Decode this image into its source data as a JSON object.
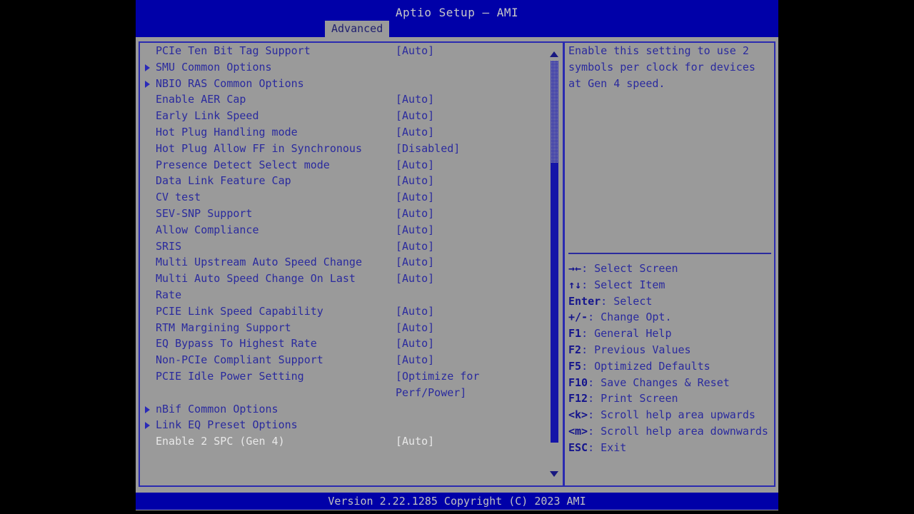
{
  "window": {
    "title": "Aptio Setup – AMI",
    "active_tab": "Advanced",
    "tabs": [
      "Advanced"
    ]
  },
  "colors": {
    "title_bar_bg": "#0000a8",
    "canvas_bg": "#9a9a9a",
    "text": "#2a2a9e",
    "selected_text": "#e8e8e8",
    "border": "#2a2ab0",
    "scrollbar_thumb": "#1414a8",
    "footer_bg": "#0000a8"
  },
  "menu": {
    "items": [
      {
        "label": "PCIe Ten Bit Tag Support",
        "value": "[Auto]",
        "submenu": false,
        "selected": false
      },
      {
        "label": "SMU Common Options",
        "value": "",
        "submenu": true,
        "selected": false
      },
      {
        "label": "NBIO RAS Common Options",
        "value": "",
        "submenu": true,
        "selected": false
      },
      {
        "label": "Enable AER Cap",
        "value": "[Auto]",
        "submenu": false,
        "selected": false
      },
      {
        "label": "Early Link Speed",
        "value": "[Auto]",
        "submenu": false,
        "selected": false
      },
      {
        "label": "Hot Plug Handling mode",
        "value": "[Auto]",
        "submenu": false,
        "selected": false
      },
      {
        "label": "Hot Plug Allow FF in Synchronous",
        "value": "[Disabled]",
        "submenu": false,
        "selected": false
      },
      {
        "label": "Presence Detect Select mode",
        "value": "[Auto]",
        "submenu": false,
        "selected": false
      },
      {
        "label": "Data Link Feature Cap",
        "value": "[Auto]",
        "submenu": false,
        "selected": false
      },
      {
        "label": "CV test",
        "value": "[Auto]",
        "submenu": false,
        "selected": false
      },
      {
        "label": "SEV-SNP Support",
        "value": "[Auto]",
        "submenu": false,
        "selected": false
      },
      {
        "label": "Allow Compliance",
        "value": "[Auto]",
        "submenu": false,
        "selected": false
      },
      {
        "label": "SRIS",
        "value": "[Auto]",
        "submenu": false,
        "selected": false
      },
      {
        "label": "Multi Upstream Auto Speed Change",
        "value": "[Auto]",
        "submenu": false,
        "selected": false
      },
      {
        "label": "Multi Auto Speed Change On Last",
        "value": "[Auto]",
        "submenu": false,
        "selected": false
      },
      {
        "label": "Rate",
        "value": "",
        "submenu": false,
        "selected": false,
        "continuation": true
      },
      {
        "label": "PCIE Link Speed Capability",
        "value": "[Auto]",
        "submenu": false,
        "selected": false
      },
      {
        "label": "RTM Margining Support",
        "value": "[Auto]",
        "submenu": false,
        "selected": false
      },
      {
        "label": "EQ Bypass To Highest Rate",
        "value": "[Auto]",
        "submenu": false,
        "selected": false
      },
      {
        "label": "Non-PCIe Compliant Support",
        "value": "[Auto]",
        "submenu": false,
        "selected": false
      },
      {
        "label": "PCIE Idle Power Setting",
        "value": "[Optimize for",
        "submenu": false,
        "selected": false
      },
      {
        "label": "",
        "value": "Perf/Power]",
        "submenu": false,
        "selected": false,
        "continuation": true
      },
      {
        "label": "nBif Common Options",
        "value": "",
        "submenu": true,
        "selected": false
      },
      {
        "label": "Link EQ Preset Options",
        "value": "",
        "submenu": true,
        "selected": false
      },
      {
        "label": "Enable 2 SPC (Gen 4)",
        "value": "[Auto]",
        "submenu": false,
        "selected": true
      }
    ]
  },
  "help": {
    "lines": [
      "Enable this setting to use 2",
      "symbols per clock for devices",
      "at Gen 4 speed."
    ]
  },
  "legend": {
    "entries": [
      {
        "key": "→←",
        "text": ": Select Screen"
      },
      {
        "key": "↑↓",
        "text": ": Select Item"
      },
      {
        "key": "Enter",
        "text": ": Select"
      },
      {
        "key": "+/-",
        "text": ": Change Opt."
      },
      {
        "key": "F1",
        "text": ": General Help"
      },
      {
        "key": "F2",
        "text": ": Previous Values"
      },
      {
        "key": "F5",
        "text": ": Optimized Defaults"
      },
      {
        "key": "F10",
        "text": ": Save Changes & Reset"
      },
      {
        "key": "F12",
        "text": ": Print Screen"
      },
      {
        "key": "<k>",
        "text": ": Scroll help area upwards"
      },
      {
        "key": "<m>",
        "text": ": Scroll help area downwards"
      },
      {
        "key": "ESC",
        "text": ": Exit"
      }
    ]
  },
  "footer": {
    "version_text": "Version 2.22.1285 Copyright (C) 2023 AMI"
  }
}
